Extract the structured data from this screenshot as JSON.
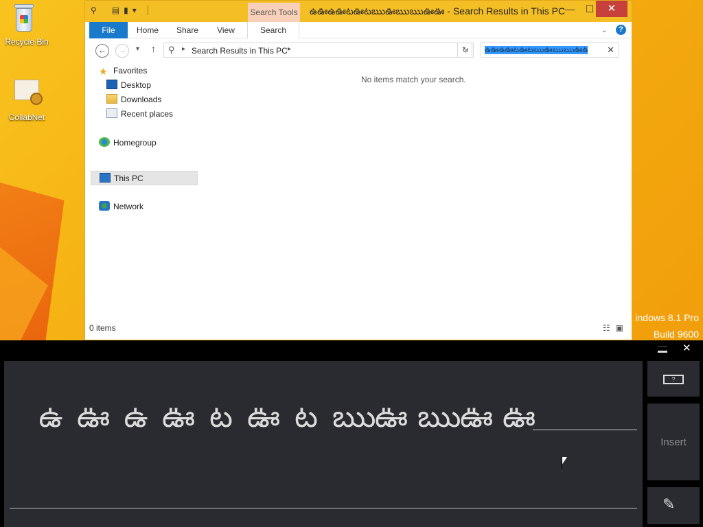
{
  "desktop": {
    "icons": [
      {
        "label": "Recycle Bin",
        "icon": "recycle-bin-icon"
      },
      {
        "label": "CollabNet",
        "icon": "certificate-icon"
      }
    ],
    "watermark": {
      "line1": "indows 8.1 Pro",
      "line2": "Build 9600"
    }
  },
  "explorer": {
    "title": "ఉఊఉఊటఊటఋఊఋఋఊఊ - Search Results in This PC",
    "contextual_tab": "Search Tools",
    "ribbon_tabs": [
      "File",
      "Home",
      "Share",
      "View",
      "Search"
    ],
    "address_path": "Search Results in This PC",
    "search_query": "ఉఊఉఊటఊటఋఊఋఋఊఊ",
    "nav": {
      "favorites": "Favorites",
      "desktop": "Desktop",
      "downloads": "Downloads",
      "recent": "Recent places",
      "homegroup": "Homegroup",
      "this_pc": "This PC",
      "network": "Network"
    },
    "empty_message": "No items match your search.",
    "status": "0 items"
  },
  "input_panel": {
    "glyphs": [
      "ఉ",
      "ఊ",
      "ఉ",
      "ఊ",
      "ట",
      "ఊ",
      "ట",
      "ఋ",
      "ఊ",
      "ఋ",
      "ఊ",
      "ఊ"
    ],
    "insert_label": "Insert",
    "keyboard_key": "?"
  },
  "colors": {
    "accent": "#1979ca",
    "titlebar": "#f4be25",
    "close": "#c7403b",
    "panel": "#2a2b31"
  }
}
